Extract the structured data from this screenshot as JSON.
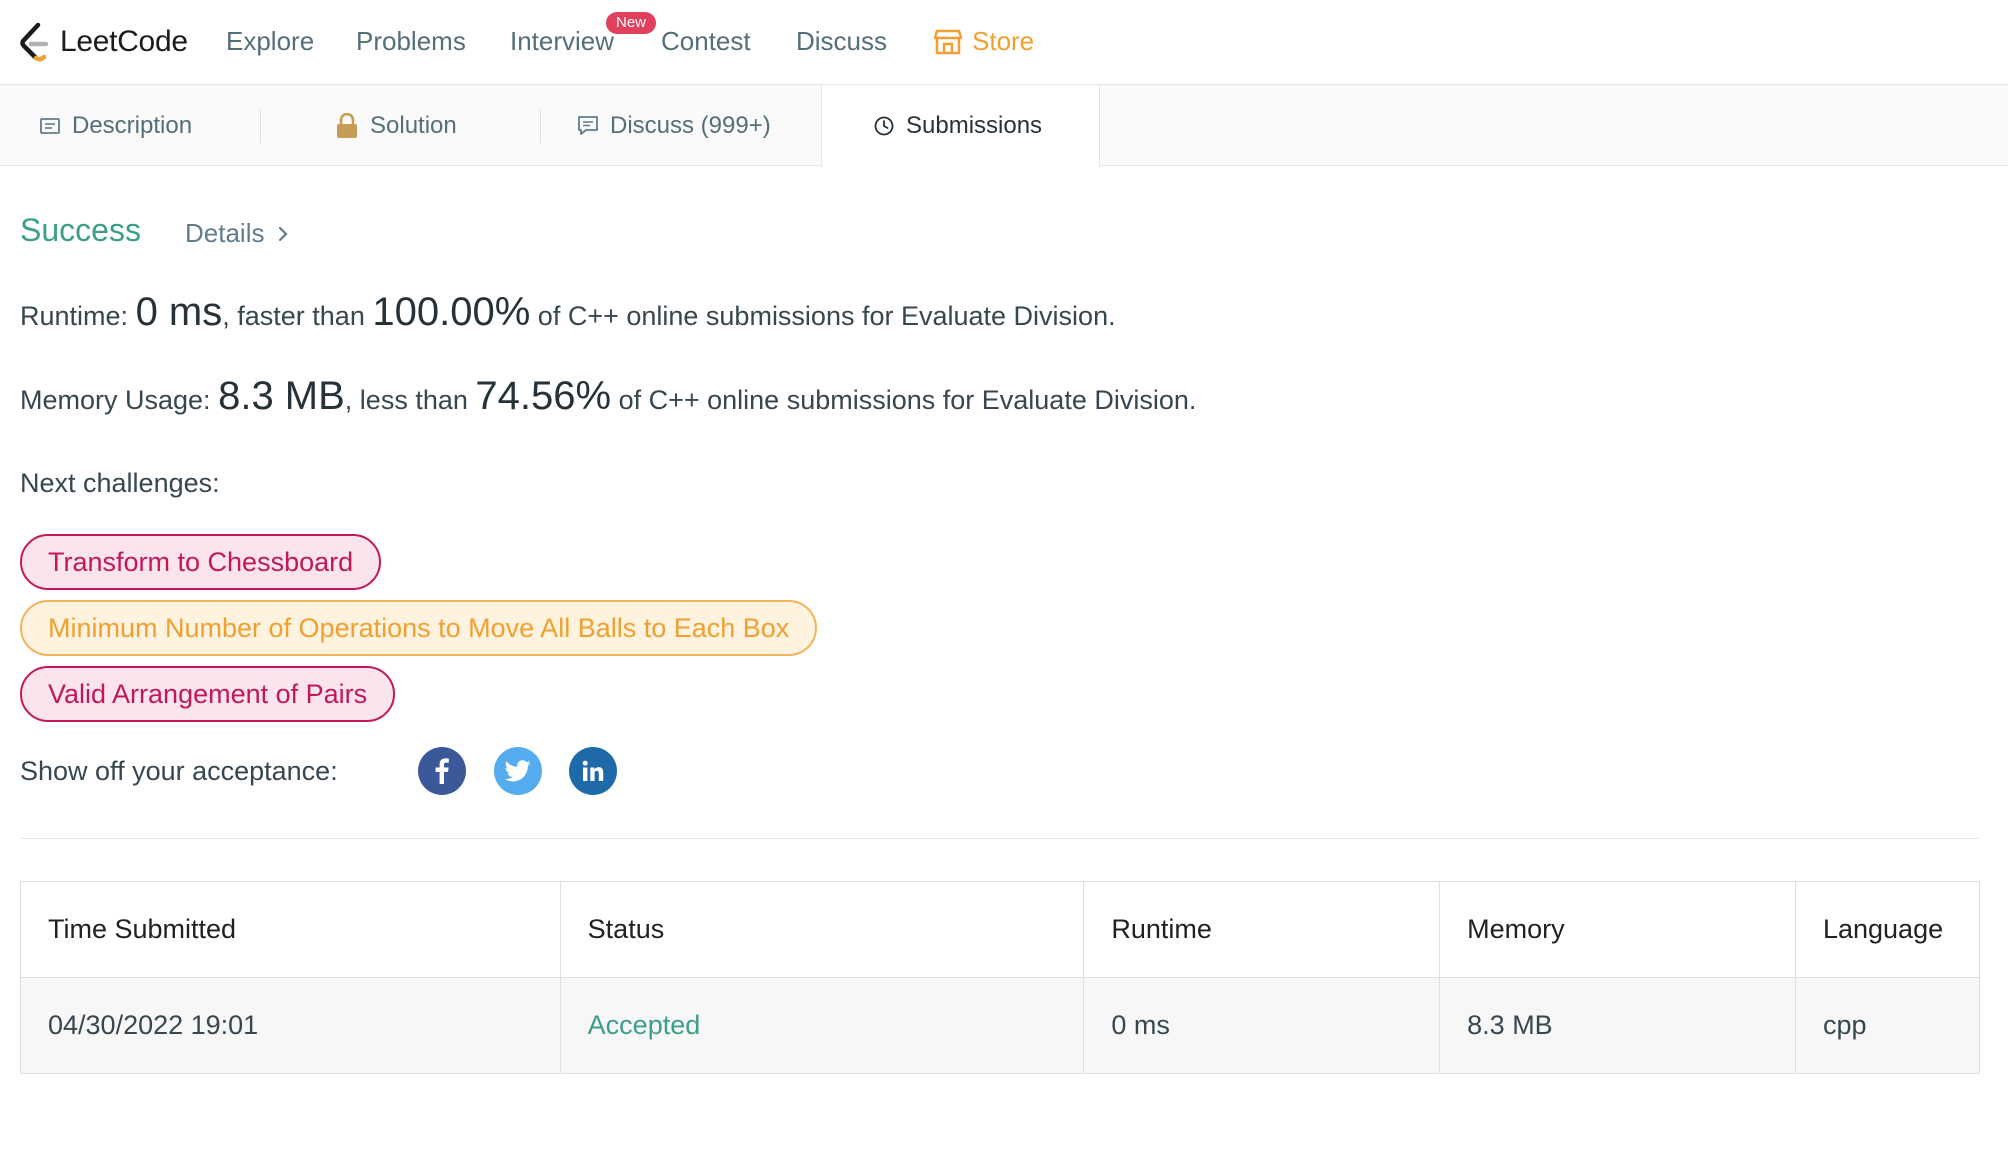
{
  "nav": {
    "logo_text": "LeetCode",
    "items": [
      "Explore",
      "Problems",
      "Interview",
      "Contest",
      "Discuss"
    ],
    "new_badge": "New",
    "store": "Store"
  },
  "tabs": [
    {
      "label": "Description",
      "icon": "description-icon"
    },
    {
      "label": "Solution",
      "icon": "lock-icon"
    },
    {
      "label": "Discuss (999+)",
      "icon": "comment-icon"
    },
    {
      "label": "Submissions",
      "icon": "clock-icon",
      "active": true
    }
  ],
  "result": {
    "status": "Success",
    "details": "Details",
    "runtime_label": "Runtime:",
    "runtime_value": "0 ms",
    "runtime_mid": ", faster than",
    "runtime_pct": "100.00%",
    "runtime_tail": "of C++ online submissions for Evaluate Division.",
    "memory_label": "Memory Usage:",
    "memory_value": "8.3 MB",
    "memory_mid": ", less than",
    "memory_pct": "74.56%",
    "memory_tail": "of C++ online submissions for Evaluate Division."
  },
  "next": {
    "label": "Next challenges:",
    "challenges": [
      {
        "title": "Transform to Chessboard",
        "difficulty": "hard"
      },
      {
        "title": "Minimum Number of Operations to Move All Balls to Each Box",
        "difficulty": "medium"
      },
      {
        "title": "Valid Arrangement of Pairs",
        "difficulty": "hard"
      }
    ]
  },
  "share": {
    "label": "Show off your acceptance:",
    "icons": [
      "facebook-icon",
      "twitter-icon",
      "linkedin-icon"
    ]
  },
  "table": {
    "headers": [
      "Time Submitted",
      "Status",
      "Runtime",
      "Memory",
      "Language"
    ],
    "rows": [
      [
        "04/30/2022 19:01",
        "Accepted",
        "0 ms",
        "8.3 MB",
        "cpp"
      ]
    ]
  },
  "colors": {
    "accent_green": "#3b9f89",
    "hard": "#c2185b",
    "medium": "#f0a030",
    "facebook": "#3b5998",
    "twitter": "#55acee",
    "linkedin": "#1e6aa8"
  }
}
